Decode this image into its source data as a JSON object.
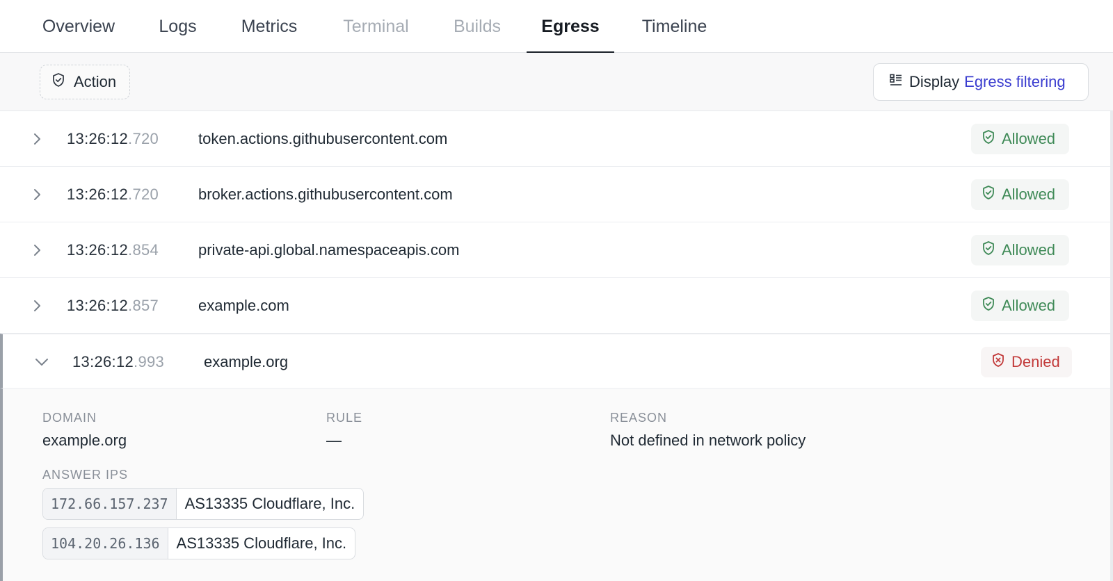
{
  "tabs": [
    {
      "label": "Overview",
      "state": "normal"
    },
    {
      "label": "Logs",
      "state": "normal"
    },
    {
      "label": "Metrics",
      "state": "normal"
    },
    {
      "label": "Terminal",
      "state": "disabled"
    },
    {
      "label": "Builds",
      "state": "disabled"
    },
    {
      "label": "Egress",
      "state": "active"
    },
    {
      "label": "Timeline",
      "state": "normal"
    }
  ],
  "toolbar": {
    "action_filter_label": "Action",
    "display_label": "Display",
    "display_value": "Egress filtering"
  },
  "rows": [
    {
      "time": "13:26:12",
      "ms": ".720",
      "domain": "token.actions.githubusercontent.com",
      "status": "Allowed"
    },
    {
      "time": "13:26:12",
      "ms": ".720",
      "domain": "broker.actions.githubusercontent.com",
      "status": "Allowed"
    },
    {
      "time": "13:26:12",
      "ms": ".854",
      "domain": "private-api.global.namespaceapis.com",
      "status": "Allowed"
    },
    {
      "time": "13:26:12",
      "ms": ".857",
      "domain": "example.com",
      "status": "Allowed"
    },
    {
      "time": "13:26:12",
      "ms": ".993",
      "domain": "example.org",
      "status": "Denied"
    }
  ],
  "detail": {
    "domain_label": "DOMAIN",
    "domain_value": "example.org",
    "rule_label": "RULE",
    "rule_value": "—",
    "reason_label": "REASON",
    "reason_value": "Not defined in network policy",
    "answer_ips_label": "ANSWER IPS",
    "answer_ips": [
      {
        "ip": "172.66.157.237",
        "asn": "AS13335 Cloudflare, Inc."
      },
      {
        "ip": "104.20.26.136",
        "asn": "AS13335 Cloudflare, Inc."
      }
    ]
  },
  "colors": {
    "allowed": "#3f8a57",
    "denied": "#c23a3a",
    "accent": "#3a3ccf"
  },
  "icons": {
    "action_filter": "shield-icon",
    "display": "list-view-icon",
    "row_collapsed": "chevron-right-icon",
    "row_expanded": "chevron-down-icon",
    "allowed": "shield-check-icon",
    "denied": "shield-x-icon"
  }
}
